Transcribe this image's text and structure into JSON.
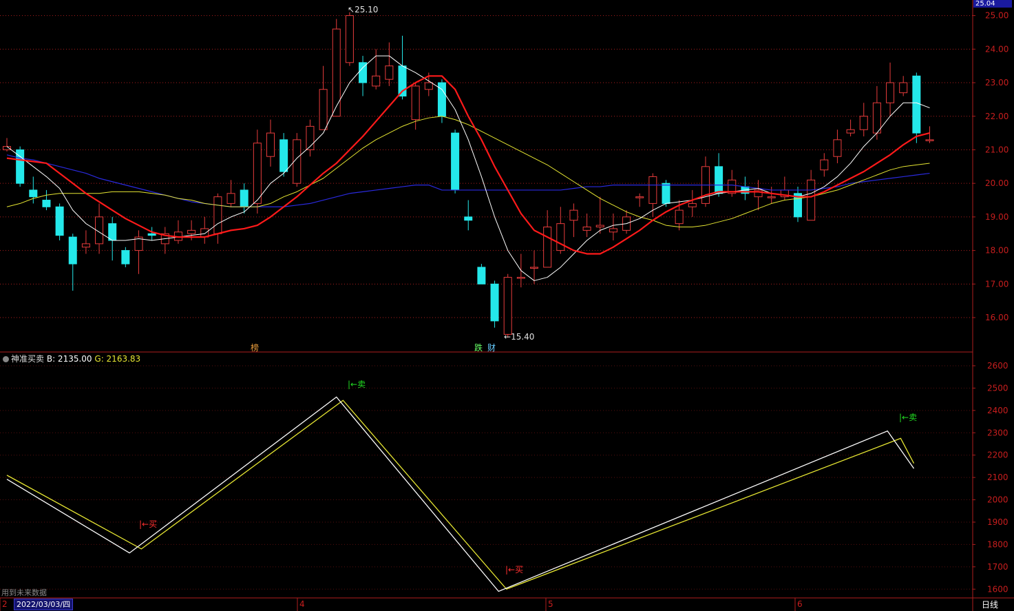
{
  "colors": {
    "up": "#e83c3c",
    "down": "#24e8ea",
    "bg": "#000000",
    "axis": "#b01e1e",
    "grid": "#b01e1e",
    "ma5": "#ffffff",
    "ma10": "#ff1a1a",
    "ma20": "#e6e632",
    "ma60": "#2a2adf",
    "b_line": "#ffffff",
    "g_line": "#e6e632",
    "buy": "#ff3030",
    "sell": "#22dd22"
  },
  "price_tag": "25.04",
  "max_label": "25.10",
  "min_label": "15.40",
  "markers": {
    "bang": "榜",
    "die": "跌",
    "cai": "财"
  },
  "indicator": {
    "name": "神准买卖",
    "b_label": "B: 2135.00",
    "g_label": "G: 2163.83"
  },
  "signals": {
    "buy": "←买",
    "sell": "←卖"
  },
  "footer": {
    "note": "用到未来数据",
    "date": "2022/03/03/四",
    "period": "日线",
    "month_marks": [
      "2",
      "4",
      "5",
      "6"
    ]
  },
  "chart_data": [
    {
      "type": "candlestick",
      "ylim": [
        15.2,
        25.3
      ],
      "y_ticks": [
        "25.00",
        "24.00",
        "23.00",
        "22.00",
        "21.00",
        "20.00",
        "19.00",
        "18.00",
        "17.00",
        "16.00"
      ],
      "candles": [
        [
          21.0,
          21.1,
          21.35,
          20.95
        ],
        [
          21.0,
          20.0,
          21.1,
          19.9
        ],
        [
          19.8,
          19.6,
          20.2,
          19.4
        ],
        [
          19.5,
          19.3,
          19.8,
          19.2
        ],
        [
          19.3,
          18.45,
          19.4,
          18.3
        ],
        [
          18.4,
          17.6,
          18.5,
          16.8
        ],
        [
          18.1,
          18.2,
          18.6,
          17.9
        ],
        [
          18.2,
          19.0,
          19.4,
          17.9
        ],
        [
          18.8,
          18.3,
          19.0,
          17.7
        ],
        [
          18.0,
          17.6,
          18.1,
          17.5
        ],
        [
          18.0,
          18.4,
          18.6,
          17.3
        ],
        [
          18.5,
          18.45,
          18.7,
          18.3
        ],
        [
          18.2,
          18.5,
          18.7,
          17.9
        ],
        [
          18.3,
          18.55,
          18.9,
          18.2
        ],
        [
          18.5,
          18.6,
          18.9,
          18.3
        ],
        [
          18.4,
          18.65,
          19.0,
          18.2
        ],
        [
          18.5,
          19.6,
          19.7,
          18.2
        ],
        [
          19.4,
          19.7,
          20.1,
          19.3
        ],
        [
          19.8,
          19.3,
          20.0,
          19.1
        ],
        [
          19.4,
          21.2,
          21.6,
          19.1
        ],
        [
          20.8,
          21.5,
          21.9,
          20.5
        ],
        [
          21.3,
          20.35,
          21.5,
          20.2
        ],
        [
          20.0,
          21.3,
          21.5,
          19.9
        ],
        [
          21.0,
          21.7,
          21.9,
          20.8
        ],
        [
          21.6,
          22.8,
          23.5,
          21.6
        ],
        [
          22.0,
          24.6,
          24.9,
          22.0
        ],
        [
          23.6,
          25.0,
          25.1,
          23.5
        ],
        [
          23.6,
          23.0,
          23.8,
          22.6
        ],
        [
          22.9,
          23.2,
          24.0,
          22.8
        ],
        [
          23.1,
          23.5,
          24.2,
          22.9
        ],
        [
          23.5,
          22.6,
          24.4,
          22.5
        ],
        [
          21.9,
          22.9,
          23.0,
          21.6
        ],
        [
          22.8,
          23.0,
          23.3,
          22.6
        ],
        [
          23.0,
          22.0,
          23.1,
          21.8
        ],
        [
          21.5,
          19.8,
          21.6,
          19.7
        ],
        [
          19.0,
          18.9,
          19.5,
          18.6
        ],
        [
          17.5,
          17.0,
          17.6,
          17.0
        ],
        [
          17.0,
          15.9,
          17.1,
          15.7
        ],
        [
          15.5,
          17.2,
          17.3,
          15.4
        ],
        [
          17.2,
          17.2,
          17.9,
          16.9
        ],
        [
          17.5,
          17.5,
          18.0,
          17.0
        ],
        [
          17.5,
          18.7,
          19.2,
          17.5
        ],
        [
          18.0,
          18.8,
          19.3,
          17.9
        ],
        [
          18.9,
          19.2,
          19.4,
          18.4
        ],
        [
          18.6,
          18.7,
          19.1,
          18.4
        ],
        [
          18.7,
          18.75,
          19.6,
          18.5
        ],
        [
          18.55,
          18.65,
          19.1,
          18.3
        ],
        [
          18.6,
          19.0,
          19.2,
          18.5
        ],
        [
          19.6,
          19.6,
          19.7,
          19.3
        ],
        [
          19.4,
          20.2,
          20.3,
          19.0
        ],
        [
          20.0,
          19.4,
          20.1,
          19.3
        ],
        [
          18.8,
          19.2,
          19.5,
          18.6
        ],
        [
          19.3,
          19.4,
          19.8,
          19.0
        ],
        [
          19.4,
          20.5,
          20.8,
          19.3
        ],
        [
          20.5,
          19.7,
          20.9,
          19.6
        ],
        [
          19.7,
          20.1,
          20.4,
          19.6
        ],
        [
          19.9,
          19.7,
          20.2,
          19.5
        ],
        [
          19.6,
          19.8,
          20.1,
          19.2
        ],
        [
          19.6,
          19.6,
          19.9,
          19.4
        ],
        [
          19.6,
          19.8,
          20.2,
          19.5
        ],
        [
          19.7,
          19.0,
          19.9,
          18.85
        ],
        [
          18.9,
          20.1,
          20.4,
          18.9
        ],
        [
          20.4,
          20.7,
          20.9,
          20.2
        ],
        [
          20.8,
          21.3,
          21.6,
          20.6
        ],
        [
          21.5,
          21.6,
          21.9,
          21.4
        ],
        [
          21.6,
          22.0,
          22.4,
          21.4
        ],
        [
          21.5,
          22.4,
          22.9,
          21.3
        ],
        [
          22.4,
          23.0,
          23.6,
          22.0
        ],
        [
          22.7,
          23.0,
          23.2,
          22.6
        ],
        [
          23.2,
          21.5,
          23.3,
          21.2
        ],
        [
          21.3,
          21.3,
          21.7,
          21.2
        ]
      ],
      "ma5": [
        21.1,
        20.8,
        20.5,
        20.2,
        19.85,
        19.2,
        18.8,
        18.55,
        18.3,
        18.3,
        18.35,
        18.3,
        18.35,
        18.4,
        18.45,
        18.5,
        18.8,
        19.0,
        19.15,
        19.5,
        20.0,
        20.3,
        20.75,
        21.1,
        21.5,
        22.3,
        23.0,
        23.45,
        23.8,
        23.8,
        23.5,
        23.3,
        23.05,
        22.8,
        22.2,
        21.3,
        20.2,
        19.0,
        18.0,
        17.4,
        17.1,
        17.2,
        17.5,
        17.9,
        18.3,
        18.6,
        18.75,
        18.8,
        18.95,
        19.2,
        19.4,
        19.45,
        19.5,
        19.6,
        19.7,
        19.75,
        19.8,
        19.85,
        19.7,
        19.65,
        19.6,
        19.7,
        19.9,
        20.2,
        20.6,
        21.1,
        21.5,
        22.0,
        22.4,
        22.4,
        22.25
      ],
      "ma10": [
        20.75,
        20.7,
        20.65,
        20.6,
        20.3,
        20.0,
        19.7,
        19.45,
        19.2,
        18.95,
        18.75,
        18.55,
        18.45,
        18.4,
        18.4,
        18.4,
        18.5,
        18.6,
        18.65,
        18.75,
        19.0,
        19.3,
        19.6,
        19.95,
        20.3,
        20.6,
        21.0,
        21.4,
        21.85,
        22.3,
        22.75,
        23.0,
        23.2,
        23.2,
        22.8,
        22.0,
        21.3,
        20.5,
        19.8,
        19.1,
        18.6,
        18.4,
        18.2,
        18.0,
        17.9,
        17.9,
        18.1,
        18.35,
        18.6,
        18.9,
        19.15,
        19.35,
        19.5,
        19.65,
        19.75,
        19.75,
        19.75,
        19.75,
        19.7,
        19.65,
        19.6,
        19.6,
        19.75,
        19.95,
        20.15,
        20.35,
        20.6,
        20.85,
        21.15,
        21.4,
        21.5
      ],
      "ma20": [
        19.3,
        19.4,
        19.55,
        19.65,
        19.7,
        19.7,
        19.7,
        19.7,
        19.75,
        19.75,
        19.75,
        19.7,
        19.65,
        19.55,
        19.5,
        19.4,
        19.35,
        19.3,
        19.3,
        19.3,
        19.4,
        19.6,
        19.75,
        19.95,
        20.15,
        20.45,
        20.75,
        21.05,
        21.3,
        21.5,
        21.7,
        21.85,
        21.95,
        22.0,
        21.9,
        21.75,
        21.55,
        21.35,
        21.15,
        20.95,
        20.75,
        20.55,
        20.3,
        20.05,
        19.8,
        19.55,
        19.35,
        19.15,
        19.0,
        18.9,
        18.75,
        18.7,
        18.7,
        18.75,
        18.85,
        18.95,
        19.1,
        19.25,
        19.4,
        19.5,
        19.55,
        19.6,
        19.7,
        19.8,
        19.95,
        20.1,
        20.25,
        20.4,
        20.5,
        20.55,
        20.6
      ],
      "ma60": [
        20.85,
        20.75,
        20.7,
        20.6,
        20.5,
        20.4,
        20.3,
        20.15,
        20.05,
        19.95,
        19.85,
        19.75,
        19.65,
        19.55,
        19.45,
        19.4,
        19.35,
        19.3,
        19.3,
        19.3,
        19.3,
        19.3,
        19.35,
        19.4,
        19.5,
        19.6,
        19.7,
        19.75,
        19.8,
        19.85,
        19.9,
        19.95,
        19.95,
        19.8,
        19.8,
        19.8,
        19.8,
        19.8,
        19.8,
        19.8,
        19.8,
        19.8,
        19.8,
        19.85,
        19.9,
        19.9,
        19.95,
        19.95,
        19.95,
        19.95,
        19.95,
        19.95,
        19.95,
        19.95,
        19.95,
        19.95,
        19.9,
        19.85,
        19.8,
        19.8,
        19.8,
        19.8,
        19.85,
        19.9,
        20.0,
        20.05,
        20.1,
        20.15,
        20.2,
        20.25,
        20.3
      ]
    },
    {
      "type": "line",
      "name": "神准买卖",
      "ylim": [
        1570,
        2640
      ],
      "y_ticks": [
        "2600",
        "2500",
        "2400",
        "2300",
        "2200",
        "2100",
        "2000",
        "1900",
        "1800",
        "1700",
        "1600"
      ],
      "b_points": [
        [
          0,
          2092
        ],
        [
          9.3,
          1762
        ],
        [
          25.0,
          2460
        ],
        [
          37.3,
          1590
        ],
        [
          66.8,
          2308
        ],
        [
          68.8,
          2140
        ]
      ],
      "g_points": [
        [
          0,
          2110
        ],
        [
          10.2,
          1780
        ],
        [
          25.5,
          2445
        ],
        [
          37.9,
          1600
        ],
        [
          67.8,
          2275
        ],
        [
          68.8,
          2163
        ]
      ]
    }
  ]
}
